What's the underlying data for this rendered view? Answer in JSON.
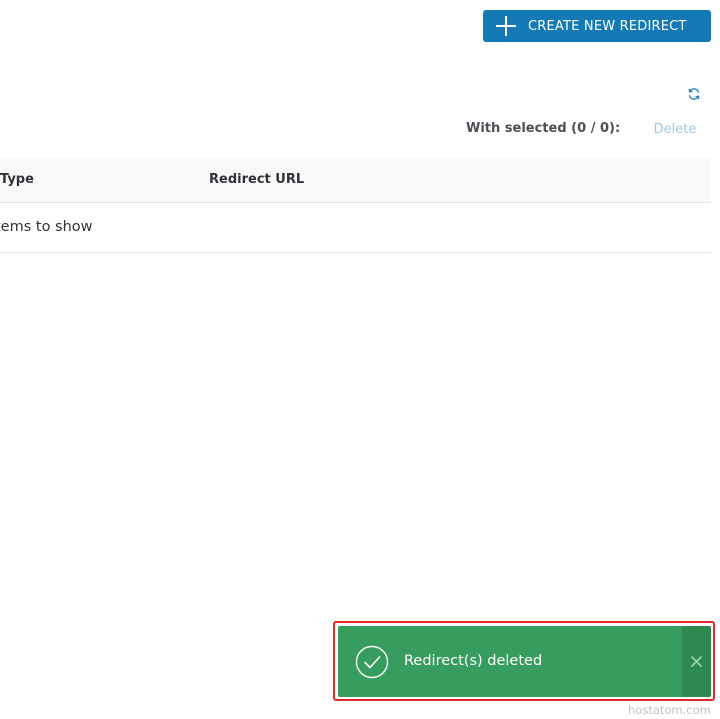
{
  "toolbar": {
    "create_label": "CREATE NEW REDIRECT",
    "with_selected": "With selected (0 / 0):",
    "delete_label": "Delete"
  },
  "table": {
    "columns": [
      "Type",
      "Redirect URL"
    ],
    "empty_text": "tems to show"
  },
  "toast": {
    "message": "Redirect(s) deleted",
    "close_glyph": "×",
    "color": "#379d5e"
  },
  "icons": {
    "create": "plus-icon",
    "refresh": "refresh-icon",
    "success": "check-circle-icon",
    "close": "close-icon"
  },
  "colors": {
    "primary": "#1579b5",
    "success": "#379d5e",
    "highlight_outline": "#e02a2a"
  },
  "watermark": "hostatom.com"
}
